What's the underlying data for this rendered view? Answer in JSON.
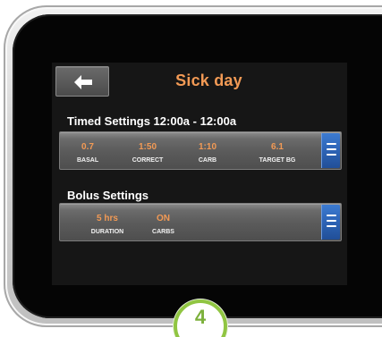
{
  "screen": {
    "title": "Sick day",
    "back_icon": "arrow-left-icon"
  },
  "timed_settings": {
    "title": "Timed Settings 12:00a - 12:00a",
    "items": [
      {
        "value": "0.7",
        "label": "BASAL"
      },
      {
        "value": "1:50",
        "label": "CORRECT"
      },
      {
        "value": "1:10",
        "label": "CARB"
      },
      {
        "value": "6.1",
        "label": "TARGET BG"
      }
    ],
    "menu_icon": "hamburger-menu-icon"
  },
  "bolus_settings": {
    "title": "Bolus Settings",
    "items": [
      {
        "value": "5 hrs",
        "label": "DURATION"
      },
      {
        "value": "ON",
        "label": "CARBS"
      }
    ],
    "menu_icon": "hamburger-menu-icon"
  },
  "step_badge": {
    "number": "4"
  },
  "colors": {
    "accent_orange": "#f29a55",
    "menu_blue": "#2e65b8",
    "badge_green": "#90c542"
  }
}
